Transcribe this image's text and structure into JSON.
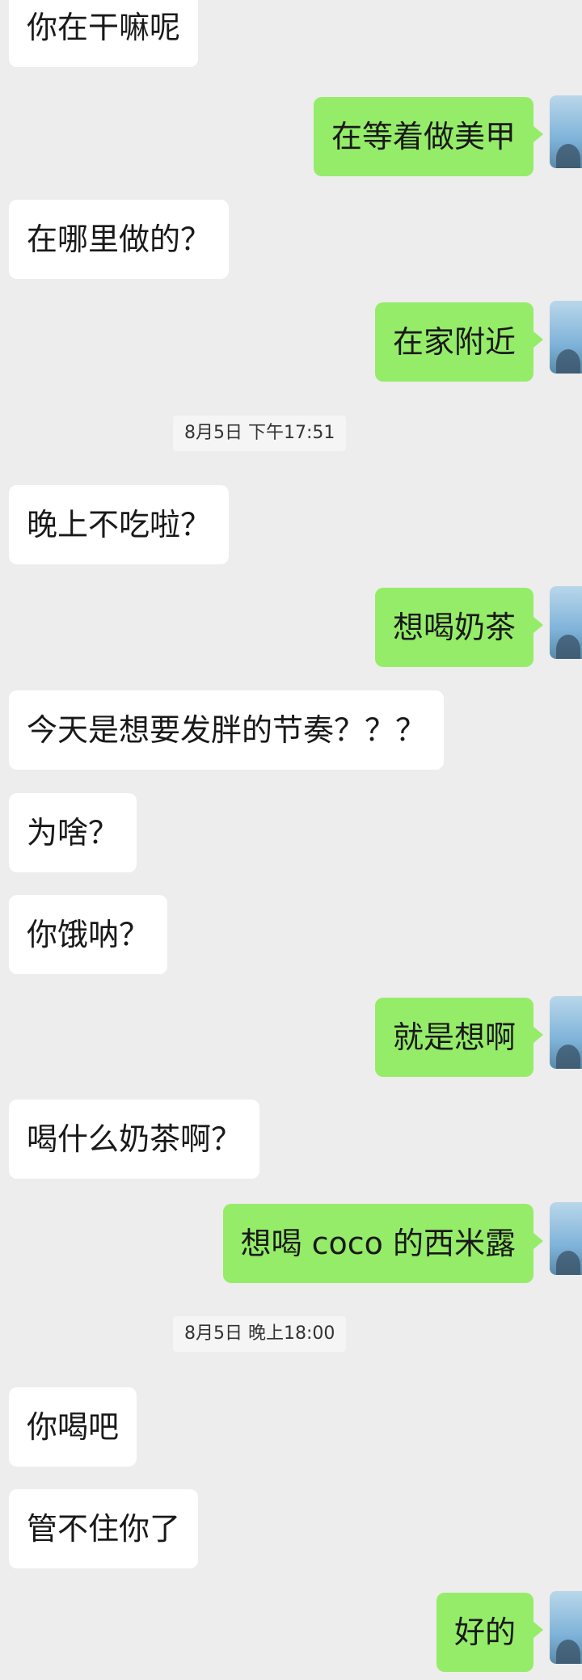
{
  "chat": {
    "messages": [
      {
        "side": "in",
        "text": "你在干嘛呢"
      },
      {
        "side": "out",
        "text": "在等着做美甲"
      },
      {
        "side": "in",
        "text": "在哪里做的？"
      },
      {
        "side": "out",
        "text": "在家附近"
      },
      {
        "type": "timestamp",
        "text": "8月5日 下午17:51"
      },
      {
        "side": "in",
        "text": "晚上不吃啦？"
      },
      {
        "side": "out",
        "text": "想喝奶茶"
      },
      {
        "side": "in",
        "text": "今天是想要发胖的节奏？？？"
      },
      {
        "side": "in",
        "text": "为啥？"
      },
      {
        "side": "in",
        "text": "你饿呐？"
      },
      {
        "side": "out",
        "text": "就是想啊"
      },
      {
        "side": "in",
        "text": "喝什么奶茶啊？"
      },
      {
        "side": "out",
        "text": "想喝 coco 的西米露"
      },
      {
        "type": "timestamp",
        "text": "8月5日 晚上18:00"
      },
      {
        "side": "in",
        "text": "你喝吧"
      },
      {
        "side": "in",
        "text": "管不住你了"
      },
      {
        "side": "out",
        "text": "好的"
      }
    ]
  },
  "colors": {
    "background": "#ededed",
    "incoming_bubble": "#ffffff",
    "outgoing_bubble": "#95ec69",
    "text": "#191919"
  }
}
